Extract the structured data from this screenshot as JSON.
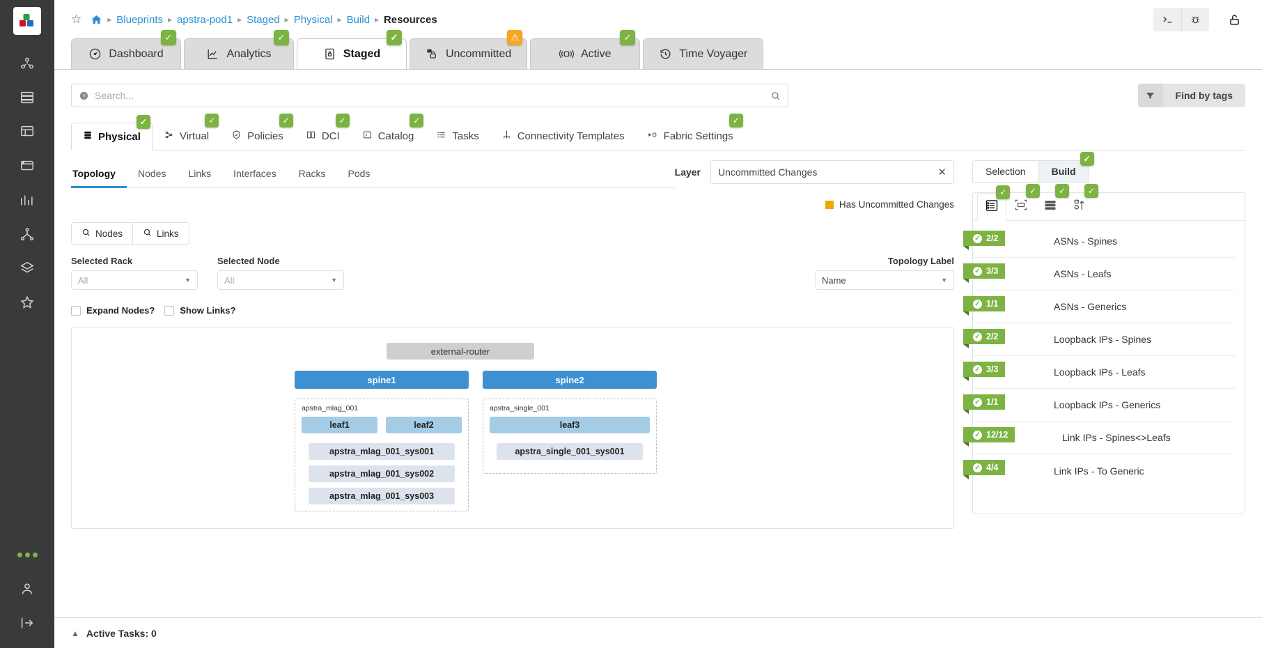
{
  "breadcrumb": {
    "items": [
      {
        "label": "Blueprints",
        "current": false
      },
      {
        "label": "apstra-pod1",
        "current": false
      },
      {
        "label": "Staged",
        "current": false
      },
      {
        "label": "Physical",
        "current": false
      },
      {
        "label": "Build",
        "current": false
      },
      {
        "label": "Resources",
        "current": true
      }
    ]
  },
  "main_tabs": [
    {
      "label": "Dashboard",
      "icon": "gauge-icon",
      "badge": "check",
      "active": false
    },
    {
      "label": "Analytics",
      "icon": "chart-line-icon",
      "badge": "check",
      "active": false
    },
    {
      "label": "Staged",
      "icon": "document-lock-icon",
      "badge": "check",
      "active": true
    },
    {
      "label": "Uncommitted",
      "icon": "box-lock-icon",
      "badge": "warning",
      "active": false
    },
    {
      "label": "Active",
      "icon": "broadcast-icon",
      "badge": "check",
      "active": false
    },
    {
      "label": "Time Voyager",
      "icon": "history-icon",
      "badge": "none",
      "active": false
    }
  ],
  "search": {
    "placeholder": "Search...",
    "value": ""
  },
  "find_by_tags": {
    "label": "Find by tags"
  },
  "section_tabs": [
    {
      "label": "Physical",
      "icon": "server-stack-icon",
      "badge": "check",
      "active": true
    },
    {
      "label": "Virtual",
      "icon": "nodes-icon",
      "badge": "check",
      "active": false
    },
    {
      "label": "Policies",
      "icon": "shield-check-icon",
      "badge": "check",
      "active": false
    },
    {
      "label": "DCI",
      "icon": "dci-icon",
      "badge": "check",
      "active": false
    },
    {
      "label": "Catalog",
      "icon": "catalog-icon",
      "badge": "check",
      "active": false
    },
    {
      "label": "Tasks",
      "icon": "tasks-icon",
      "badge": "none",
      "active": false
    },
    {
      "label": "Connectivity Templates",
      "icon": "connectivity-icon",
      "badge": "none",
      "active": false
    },
    {
      "label": "Fabric Settings",
      "icon": "fabric-settings-icon",
      "badge": "check",
      "active": false
    }
  ],
  "view_tabs": [
    {
      "label": "Topology",
      "active": true
    },
    {
      "label": "Nodes",
      "active": false
    },
    {
      "label": "Links",
      "active": false
    },
    {
      "label": "Interfaces",
      "active": false
    },
    {
      "label": "Racks",
      "active": false
    },
    {
      "label": "Pods",
      "active": false
    }
  ],
  "layer": {
    "label": "Layer",
    "value": "Uncommitted Changes",
    "clear_icon": "close-icon"
  },
  "legend": {
    "color": "#f0a500",
    "text": "Has Uncommitted Changes"
  },
  "node_link_buttons": [
    {
      "label": "Nodes",
      "icon": "search-icon"
    },
    {
      "label": "Links",
      "icon": "search-icon"
    }
  ],
  "filters": {
    "selected_rack": {
      "label": "Selected Rack",
      "value": "All"
    },
    "selected_node": {
      "label": "Selected Node",
      "value": "All"
    },
    "topology_label": {
      "label": "Topology Label",
      "value": "Name"
    }
  },
  "checkboxes": [
    {
      "label": "Expand Nodes?",
      "checked": false
    },
    {
      "label": "Show Links?",
      "checked": false
    }
  ],
  "topology": {
    "external_router": "external-router",
    "spines": [
      "spine1",
      "spine2"
    ],
    "racks": [
      {
        "title": "apstra_mlag_001",
        "leafs": [
          "leaf1",
          "leaf2"
        ],
        "servers": [
          "apstra_mlag_001_sys001",
          "apstra_mlag_001_sys002",
          "apstra_mlag_001_sys003"
        ]
      },
      {
        "title": "apstra_single_001",
        "leafs": [
          "leaf3"
        ],
        "servers": [
          "apstra_single_001_sys001"
        ]
      }
    ]
  },
  "side_panel": {
    "tabs": [
      {
        "label": "Selection",
        "active": false,
        "badge": "none"
      },
      {
        "label": "Build",
        "active": true,
        "badge": "check"
      }
    ],
    "icon_tabs": [
      {
        "icon": "list-details-icon",
        "badge": "check",
        "active": true
      },
      {
        "icon": "device-scan-icon",
        "badge": "check",
        "active": false
      },
      {
        "icon": "server-rack-icon",
        "badge": "check",
        "active": false
      },
      {
        "icon": "sort-up-icon",
        "badge": "check",
        "active": false
      }
    ],
    "resources": [
      {
        "count": "2/2",
        "label": "ASNs - Spines"
      },
      {
        "count": "3/3",
        "label": "ASNs - Leafs"
      },
      {
        "count": "1/1",
        "label": "ASNs - Generics"
      },
      {
        "count": "2/2",
        "label": "Loopback IPs - Spines"
      },
      {
        "count": "3/3",
        "label": "Loopback IPs - Leafs"
      },
      {
        "count": "1/1",
        "label": "Loopback IPs - Generics"
      },
      {
        "count": "12/12",
        "label": "Link IPs - Spines<>Leafs"
      },
      {
        "count": "4/4",
        "label": "Link IPs - To Generic"
      }
    ]
  },
  "bottom_bar": {
    "label": "Active Tasks: 0"
  },
  "colors": {
    "accent_blue": "#2a8fd4",
    "green_badge": "#7cb342",
    "warn_orange": "#f5a623",
    "spine_blue": "#3d90d2",
    "leaf_blue": "#a4cce6"
  }
}
